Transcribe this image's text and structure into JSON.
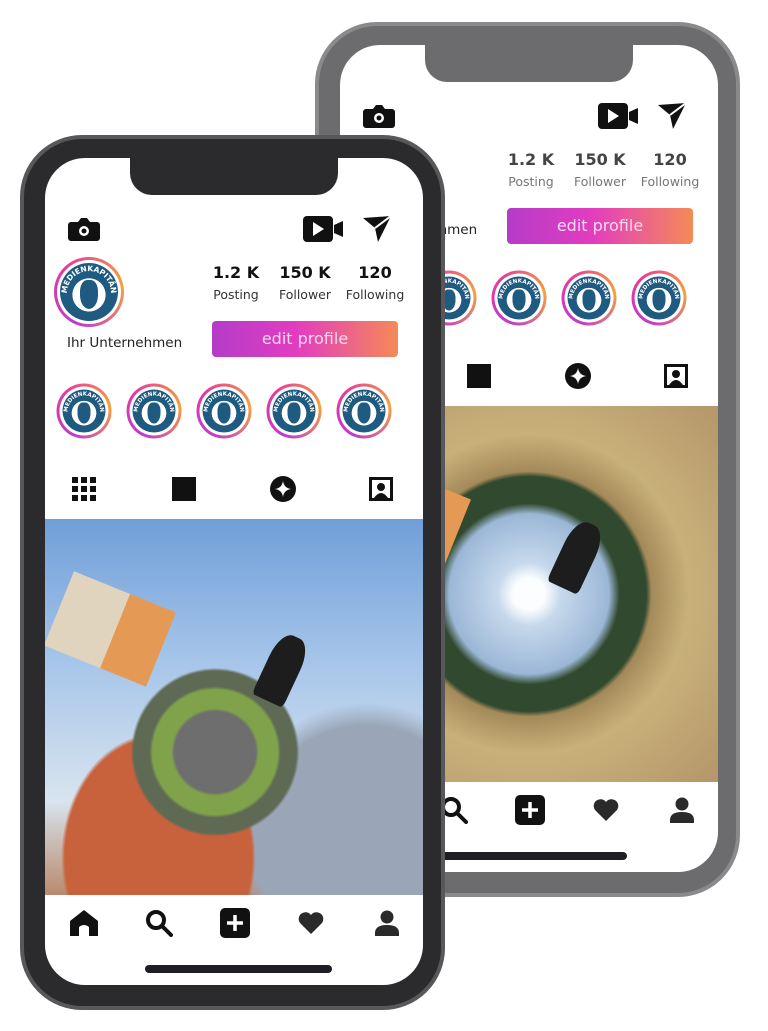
{
  "profile": {
    "name": "Ihr Unternehmen",
    "avatar_logo_text": "MEDIENKAPITÄN",
    "stats": [
      {
        "value": "1.2 K",
        "label": "Posting"
      },
      {
        "value": "150 K",
        "label": "Follower"
      },
      {
        "value": "120",
        "label": "Following"
      }
    ],
    "edit_label": "edit profile"
  },
  "header_icons": [
    "camera-icon",
    "video-icon",
    "send-icon"
  ],
  "stories_count": 5,
  "tabs": [
    "grid-icon",
    "square-icon",
    "tagged-star-icon",
    "portrait-icon"
  ],
  "bottom_nav": [
    "home-icon",
    "search-icon",
    "add-post-icon",
    "heart-icon",
    "profile-icon"
  ],
  "colors": {
    "gradient_start": "#b43cc8",
    "gradient_mid": "#e23cc0",
    "gradient_end": "#f58a56",
    "logo_blue": "#1f5a80"
  }
}
